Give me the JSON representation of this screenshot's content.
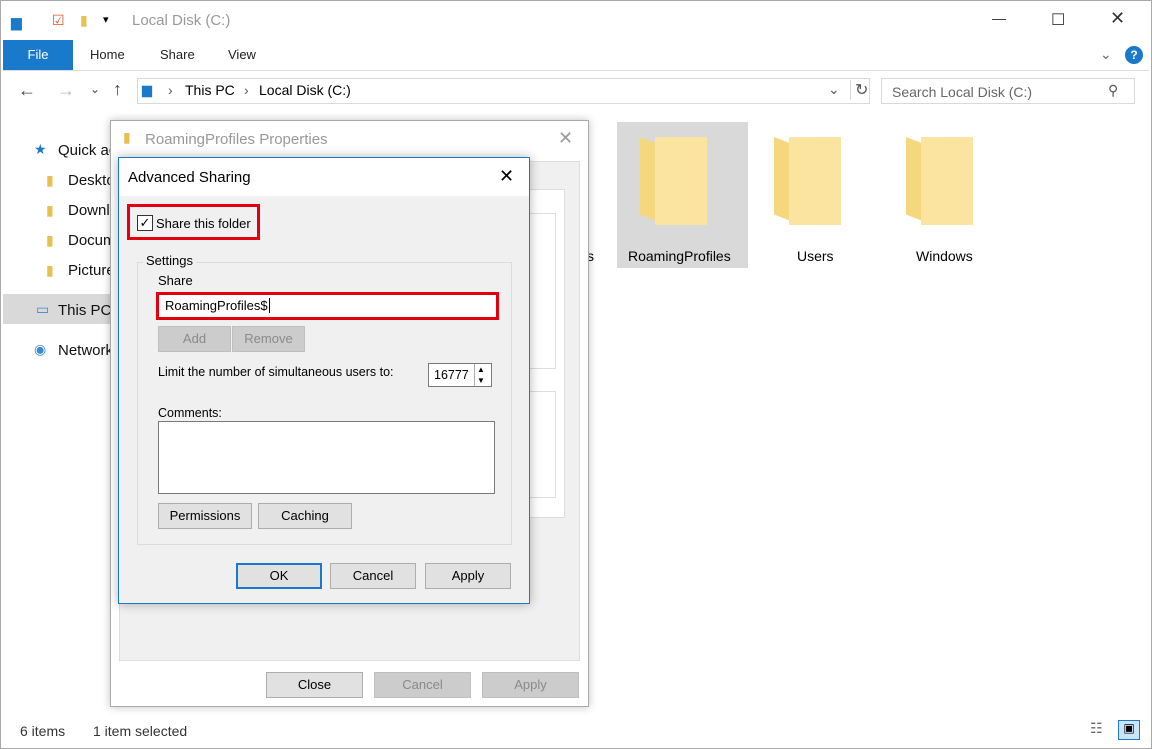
{
  "window": {
    "title": "Local Disk (C:)",
    "controls": [
      "minimize",
      "maximize",
      "close"
    ]
  },
  "ribbon": {
    "tabs": [
      "File",
      "Home",
      "Share",
      "View"
    ]
  },
  "address": {
    "crumbs": [
      "This PC",
      "Local Disk (C:)"
    ],
    "search_placeholder": "Search Local Disk (C:)"
  },
  "nav": {
    "items": [
      "Quick access",
      "Desktop",
      "Downloads",
      "Documents",
      "Pictures",
      "This PC",
      "Network"
    ]
  },
  "files": [
    {
      "name": "RoamingProfiles",
      "selected": true
    },
    {
      "name": "Users"
    },
    {
      "name": "Windows"
    }
  ],
  "partial_label": "s",
  "status": {
    "items": "6 items",
    "selected": "1 item selected"
  },
  "properties": {
    "title": "RoamingProfiles Properties",
    "close": "Close",
    "cancel": "Cancel",
    "apply": "Apply"
  },
  "advanced": {
    "title": "Advanced Sharing",
    "share_checkbox": "Share this folder",
    "checked": true,
    "settings": "Settings",
    "share_label": "Share",
    "share_value": "RoamingProfiles$",
    "add": "Add",
    "remove": "Remove",
    "limit_label": "Limit the number of simultaneous users to:",
    "limit_value": "16777",
    "comments_label": "Comments:",
    "permissions": "Permissions",
    "caching": "Caching",
    "ok": "OK",
    "cancel": "Cancel",
    "apply": "Apply"
  },
  "colors": {
    "accent": "#1979ca",
    "highlight": "#e00010"
  }
}
